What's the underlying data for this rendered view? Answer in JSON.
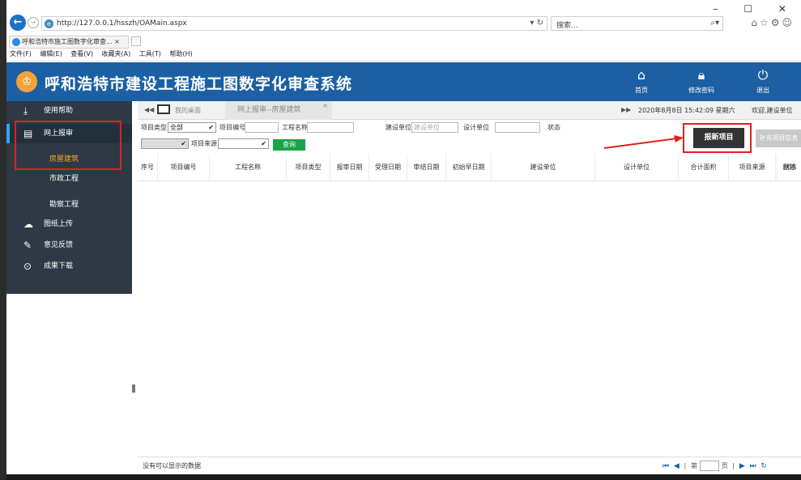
{
  "browser": {
    "url": "http://127.0.0.1/hsszh/OAMain.aspx",
    "search_placeholder": "搜索...",
    "tab_title": "呼和浩特市施工图数字化审查... ×",
    "menu": [
      "文件(F)",
      "编辑(E)",
      "查看(V)",
      "收藏夹(A)",
      "工具(T)",
      "帮助(H)"
    ]
  },
  "app": {
    "title": "呼和浩特市建设工程施工图数字化审查系统",
    "header_buttons": [
      {
        "label": "首页",
        "icon": "home-icon"
      },
      {
        "label": "修改密码",
        "icon": "lock-icon"
      },
      {
        "label": "退出",
        "icon": "power-icon"
      }
    ]
  },
  "sidebar": {
    "items": [
      {
        "label": "使用帮助",
        "icon": "download-icon"
      },
      {
        "label": "网上报审",
        "icon": "card-icon"
      },
      {
        "label": "房屋建筑",
        "icon": ""
      },
      {
        "label": "市政工程",
        "icon": ""
      },
      {
        "label": "勘察工程",
        "icon": ""
      },
      {
        "label": "图纸上传",
        "icon": "cloud-upload-icon"
      },
      {
        "label": "意见反馈",
        "icon": "edit-icon"
      },
      {
        "label": "成果下载",
        "icon": "circle-download-icon"
      }
    ]
  },
  "tabs": {
    "desktop": "我的桌面",
    "current": "网上报审--房屋建筑",
    "datetime": "2020年8月8日 15:42:09 星期六",
    "welcome": "欢迎,建设单位"
  },
  "filter": {
    "project_type_label": "项目类型",
    "project_type_value": "全部",
    "project_no_label": "项目编号",
    "project_name_label": "工程名称",
    "build_unit_label": "建设单位",
    "build_unit_placeholder": "建设单位",
    "design_unit_label": "设计单位",
    "status_label": "状态",
    "project_source_label": "项目来源",
    "query_button": "查询",
    "new_project_button": "报新项目",
    "supplement_button": "补充项目信息"
  },
  "table": {
    "columns": [
      "序号",
      "项目编号",
      "工程名称",
      "项目类型",
      "报审日期",
      "受理日期",
      "审结日期",
      "初始早日期",
      "建设单位",
      "设计单位",
      "合计面积",
      "项目来源",
      "状态",
      "删除"
    ],
    "rows": []
  },
  "footer": {
    "no_data": "没有可以显示的数据",
    "page_label": "第",
    "page_suffix": "页"
  },
  "colors": {
    "header_blue": "#1c5fa3",
    "sidebar_dark": "#2e3945",
    "accent_orange": "#f5a623",
    "query_green": "#1aa34a",
    "highlight_red": "#e02020"
  }
}
